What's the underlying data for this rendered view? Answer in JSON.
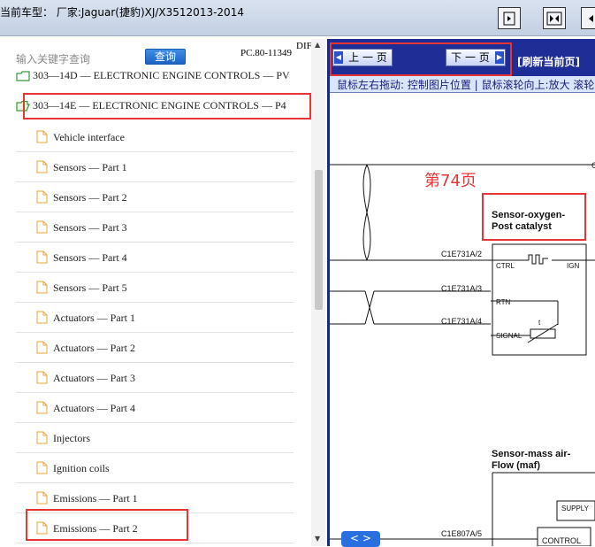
{
  "header": {
    "car_label": "当前车型： 厂家:Jaguar(捷豹)XJ/X3512013-2014"
  },
  "search": {
    "placeholder": "输入关键字查询",
    "button_label": "查询",
    "pc_code": "PC.80-11349",
    "dir_label": "DIF"
  },
  "tree": {
    "folders": [
      {
        "label": "303—14D — ELECTRONIC ENGINE CONTROLS — PV"
      },
      {
        "label": "303—14E — ELECTRONIC ENGINE CONTROLS — P4"
      }
    ],
    "items": [
      {
        "label": "Vehicle interface"
      },
      {
        "label": "Sensors — Part 1"
      },
      {
        "label": "Sensors — Part 2"
      },
      {
        "label": "Sensors — Part 3"
      },
      {
        "label": "Sensors — Part 4"
      },
      {
        "label": "Sensors — Part 5"
      },
      {
        "label": "Actuators — Part 1"
      },
      {
        "label": "Actuators — Part 2"
      },
      {
        "label": "Actuators — Part 3"
      },
      {
        "label": "Actuators — Part 4"
      },
      {
        "label": "Injectors"
      },
      {
        "label": "Ignition coils"
      },
      {
        "label": "Emissions — Part 1"
      },
      {
        "label": "Emissions — Part 2"
      }
    ]
  },
  "viewer": {
    "prev_label": "上 一 页",
    "next_label": "下 一 页",
    "refresh_label": "[刷新当前页]",
    "hint": "鼠标左右拖动: 控制图片位置 | 鼠标滚轮向上:放大   滚轮",
    "page_number": "第74页",
    "expand_label": "< >"
  },
  "diagram": {
    "sensor1_title_line1": "Sensor-oxygen-",
    "sensor1_title_line2": "Post catalyst",
    "pin1": "C1E731A/2",
    "pin2": "C1E731A/3",
    "pin3": "C1E731A/4",
    "ctrl": "CTRL",
    "ign": "IGN",
    "rtn": "RTN",
    "signal": "SIGNAL",
    "t_label": "t",
    "sensor2_title_line1": "Sensor-mass air-",
    "sensor2_title_line2": "Flow (maf)",
    "supply": "SUPPLY",
    "pin4": "C1E807A/5",
    "control": "CONTROL",
    "edge_c": "C"
  },
  "colors": {
    "highlight": "#e53535",
    "nav_bar": "#1f2d96",
    "accent_blue": "#2a6fe0"
  }
}
